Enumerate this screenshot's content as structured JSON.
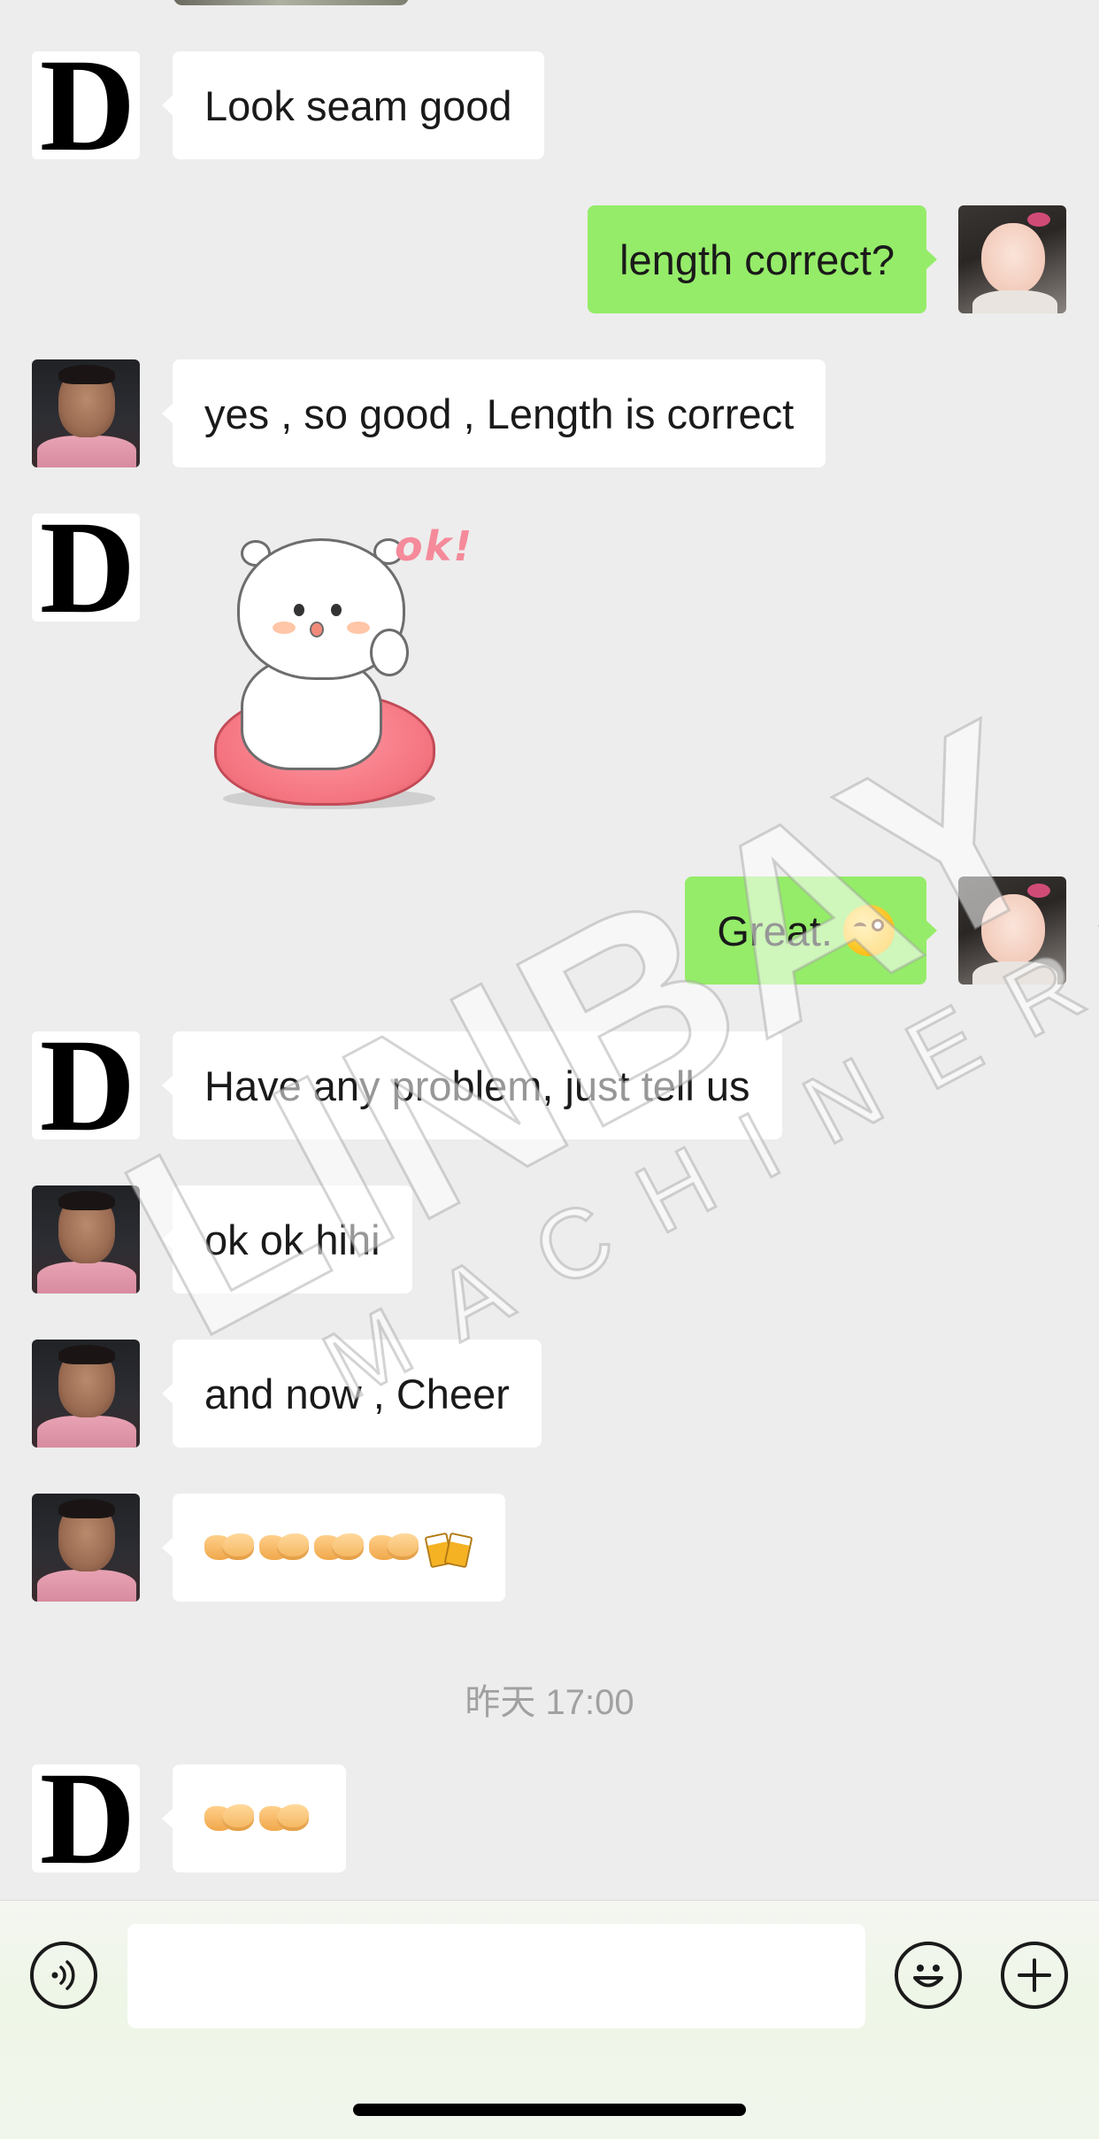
{
  "contacts": {
    "d_avatar_letter": "D"
  },
  "messages": [
    {
      "side": "in",
      "avatar": "d-logo",
      "text": "Look seam good"
    },
    {
      "side": "out",
      "avatar": "baby-photo",
      "text": "length correct?"
    },
    {
      "side": "in",
      "avatar": "man-photo",
      "text": "yes , so good , Length is correct"
    },
    {
      "side": "in",
      "avatar": "d-logo",
      "type": "sticker",
      "sticker_text": "ok!"
    },
    {
      "side": "out",
      "avatar": "baby-photo",
      "text": "Great.",
      "emoji": "winking-face-icon"
    },
    {
      "side": "in",
      "avatar": "d-logo",
      "text": "Have any problem, just tell us"
    },
    {
      "side": "in",
      "avatar": "man-photo",
      "text": "ok ok hihi"
    },
    {
      "side": "in",
      "avatar": "man-photo",
      "text": "and now , Cheer"
    },
    {
      "side": "in",
      "avatar": "man-photo",
      "emojis": [
        "handshake-icon",
        "handshake-icon",
        "handshake-icon",
        "handshake-icon",
        "clinking-beer-mugs-icon"
      ]
    },
    {
      "side": "in",
      "avatar": "d-logo",
      "emojis": [
        "handshake-icon",
        "handshake-icon"
      ]
    }
  ],
  "timestamp": "昨天 17:00",
  "watermark": {
    "line1": "LINBAY",
    "line2": "MACHINERY"
  },
  "input_bar": {
    "voice_icon": "voice-icon",
    "emoji_icon": "smiley-icon",
    "plus_icon": "plus-icon",
    "text_value": ""
  },
  "colors": {
    "background": "#ededed",
    "outgoing_bubble": "#95ec69",
    "incoming_bubble": "#ffffff",
    "timestamp": "#a1a1a1"
  }
}
